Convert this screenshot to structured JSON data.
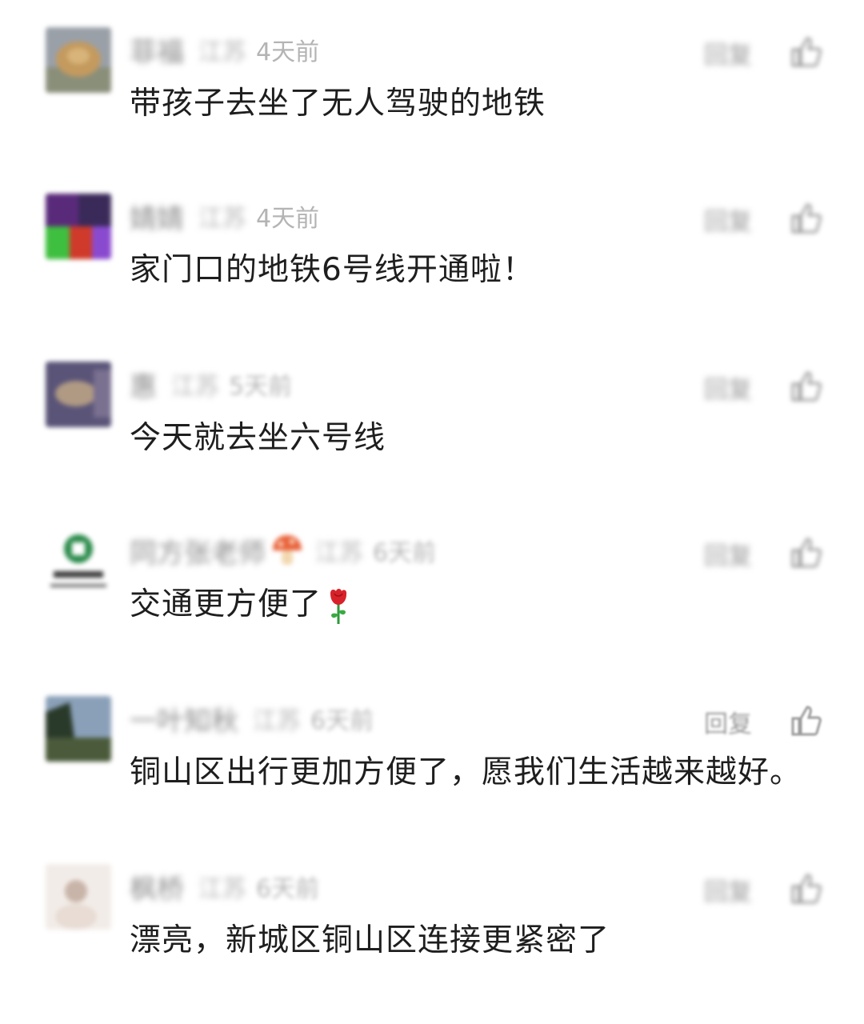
{
  "comments": [
    {
      "nickname": "菲福",
      "location": "江苏",
      "time": "4天前",
      "text": "带孩子去坐了无人驾驶的地铁",
      "reply_label": "回复",
      "like_icon": "thumbs-up-icon",
      "avatar_colors": [
        "#c49a5e",
        "#8a8f7a",
        "#9aa0a8"
      ]
    },
    {
      "nickname": "婧婧",
      "location": "江苏",
      "time": "4天前",
      "text": "家门口的地铁6号线开通啦！",
      "reply_label": "回复",
      "like_icon": "thumbs-up-icon",
      "avatar_colors": [
        "#5a2a7a",
        "#3fbf3f",
        "#d03a2a"
      ]
    },
    {
      "nickname": "惠",
      "location": "江苏",
      "time": "5天前",
      "text": "今天就去坐六号线",
      "reply_label": "回复",
      "like_icon": "thumbs-up-icon",
      "avatar_colors": [
        "#5a5478",
        "#b09a84",
        "#7a7090"
      ]
    },
    {
      "nickname": "同方张老师",
      "location": "江苏",
      "time": "6天前",
      "text": "交通更方便了",
      "reply_label": "回复",
      "like_icon": "thumbs-up-icon",
      "avatar_colors": [
        "#ffffff",
        "#2a8a4a",
        "#3a3a3a"
      ]
    },
    {
      "nickname": "一叶知秋",
      "location": "江苏",
      "time": "6天前",
      "text": "铜山区出行更加方便了，愿我们生活越来越好。",
      "reply_label": "回复",
      "like_icon": "thumbs-up-icon",
      "avatar_colors": [
        "#4a5a3a",
        "#8aa0b8",
        "#2a3a2a"
      ]
    },
    {
      "nickname": "枫桥",
      "location": "江苏",
      "time": "6天前",
      "text": "漂亮，新城区铜山区连接更紧密了",
      "reply_label": "回复",
      "like_icon": "thumbs-up-icon",
      "avatar_colors": [
        "#e8dcd4",
        "#c8b4a8",
        "#f2ece8"
      ]
    }
  ],
  "colors": {
    "text": "#1e1e1e",
    "meta": "#b4b4b4",
    "nickname": "#8c8c8c"
  }
}
